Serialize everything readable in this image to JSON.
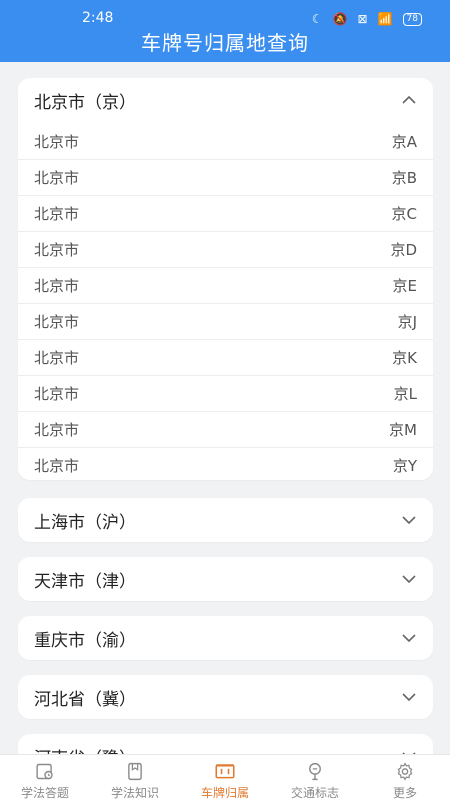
{
  "status_bar": {
    "time": "2:48",
    "battery": "78"
  },
  "header": {
    "title": "车牌号归属地查询"
  },
  "cards": [
    {
      "title": "北京市（京）",
      "expanded": true,
      "rows": [
        {
          "city": "北京市",
          "code": "京A"
        },
        {
          "city": "北京市",
          "code": "京B"
        },
        {
          "city": "北京市",
          "code": "京C"
        },
        {
          "city": "北京市",
          "code": "京D"
        },
        {
          "city": "北京市",
          "code": "京E"
        },
        {
          "city": "北京市",
          "code": "京J"
        },
        {
          "city": "北京市",
          "code": "京K"
        },
        {
          "city": "北京市",
          "code": "京L"
        },
        {
          "city": "北京市",
          "code": "京M"
        },
        {
          "city": "北京市",
          "code": "京Y"
        }
      ]
    },
    {
      "title": "上海市（沪）",
      "expanded": false
    },
    {
      "title": "天津市（津）",
      "expanded": false
    },
    {
      "title": "重庆市（渝）",
      "expanded": false
    },
    {
      "title": "河北省（冀）",
      "expanded": false
    },
    {
      "title": "河南省（豫）",
      "expanded": false
    }
  ],
  "tabbar": [
    {
      "label": "学法答题",
      "icon": "quiz-icon",
      "active": false
    },
    {
      "label": "学法知识",
      "icon": "book-icon",
      "active": false
    },
    {
      "label": "车牌归属",
      "icon": "plate-icon",
      "active": true
    },
    {
      "label": "交通标志",
      "icon": "sign-icon",
      "active": false
    },
    {
      "label": "更多",
      "icon": "gear-icon",
      "active": false
    }
  ],
  "colors": {
    "header": "#3a8ef0",
    "accent": "#e07a32",
    "background": "#f1f2f4"
  }
}
